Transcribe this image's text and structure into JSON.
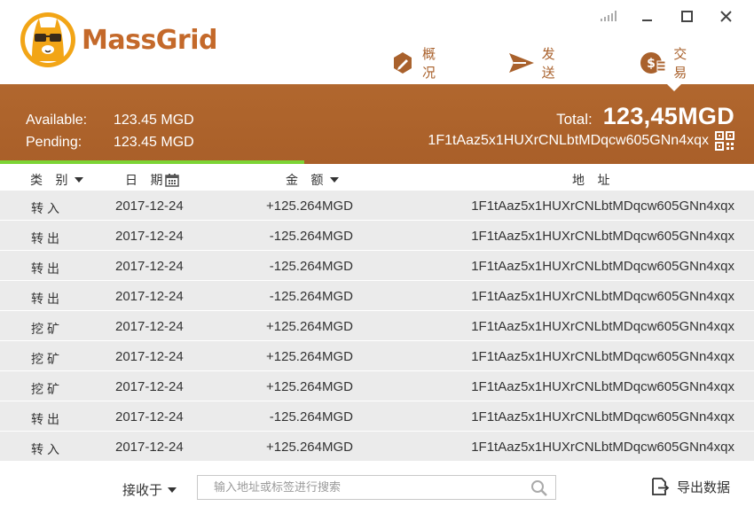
{
  "app": {
    "name": "MassGrid"
  },
  "nav": {
    "overview": "概 况",
    "send": "发 送",
    "transactions": "交 易"
  },
  "balance": {
    "available_label": "Available:",
    "available_value": "123.45 MGD",
    "pending_label": "Pending:",
    "pending_value": "123.45 MGD",
    "total_label": "Total:",
    "total_value": "123,45MGD",
    "address": "1F1tAaz5x1HUXrCNLbtMDqcw605GNn4xqx",
    "sync_progress_fraction": 0.403
  },
  "columns": {
    "type": "类 别",
    "date": "日 期",
    "amount": "金 额",
    "address": "地 址"
  },
  "transactions": [
    {
      "type": "转入",
      "date": "2017-12-24",
      "amount": "+125.264MGD",
      "address": "1F1tAaz5x1HUXrCNLbtMDqcw605GNn4xqx"
    },
    {
      "type": "转出",
      "date": "2017-12-24",
      "amount": "-125.264MGD",
      "address": "1F1tAaz5x1HUXrCNLbtMDqcw605GNn4xqx"
    },
    {
      "type": "转出",
      "date": "2017-12-24",
      "amount": "-125.264MGD",
      "address": "1F1tAaz5x1HUXrCNLbtMDqcw605GNn4xqx"
    },
    {
      "type": "转出",
      "date": "2017-12-24",
      "amount": "-125.264MGD",
      "address": "1F1tAaz5x1HUXrCNLbtMDqcw605GNn4xqx"
    },
    {
      "type": "挖矿",
      "date": "2017-12-24",
      "amount": "+125.264MGD",
      "address": "1F1tAaz5x1HUXrCNLbtMDqcw605GNn4xqx"
    },
    {
      "type": "挖矿",
      "date": "2017-12-24",
      "amount": "+125.264MGD",
      "address": "1F1tAaz5x1HUXrCNLbtMDqcw605GNn4xqx"
    },
    {
      "type": "挖矿",
      "date": "2017-12-24",
      "amount": "+125.264MGD",
      "address": "1F1tAaz5x1HUXrCNLbtMDqcw605GNn4xqx"
    },
    {
      "type": "转出",
      "date": "2017-12-24",
      "amount": "-125.264MGD",
      "address": "1F1tAaz5x1HUXrCNLbtMDqcw605GNn4xqx"
    },
    {
      "type": "转入",
      "date": "2017-12-24",
      "amount": "+125.264MGD",
      "address": "1F1tAaz5x1HUXrCNLbtMDqcw605GNn4xqx"
    }
  ],
  "footer": {
    "filter_value": "接收于",
    "search_placeholder": "输入地址或标签进行搜索",
    "export_label": "导出数据"
  },
  "colors": {
    "brand": "#c4692a",
    "band": "#ab6029",
    "progress": "#7cd435",
    "row_bg": "#ebebeb"
  },
  "icons": {
    "logo": "alpaca-with-glasses-logo",
    "overview": "pencil-square-icon",
    "send": "paper-plane-icon",
    "transactions": "coin-list-icon",
    "qr": "qr-code-icon",
    "calendar": "calendar-icon",
    "search": "search-icon",
    "export": "export-file-icon"
  }
}
